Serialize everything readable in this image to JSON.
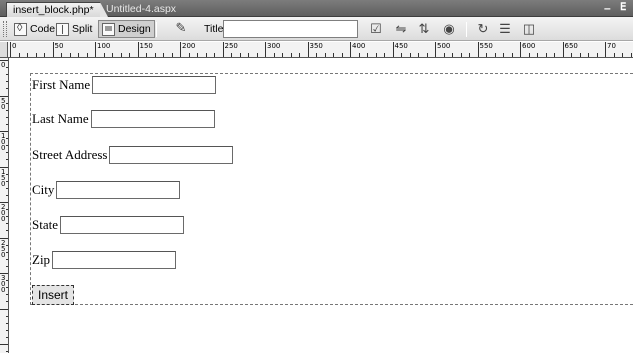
{
  "tabs": [
    {
      "label": "insert_block.php*",
      "active": true
    },
    {
      "label": "Untitled-4.aspx",
      "active": false
    }
  ],
  "window_controls": {
    "minimize": "–",
    "restore": "ⴹ"
  },
  "toolbar": {
    "code_label": "Code",
    "split_label": "Split",
    "design_label": "Design",
    "active_view": "Design",
    "title_label": "Title:",
    "title_value": "",
    "icons": [
      "live-data-icon",
      "browser-check-icon",
      "file-management-icon",
      "preview-icon",
      "refresh-icon",
      "view-options-icon",
      "visual-aids-icon"
    ]
  },
  "ruler": {
    "top_labels": [
      "0",
      "50",
      "100",
      "150",
      "200",
      "250",
      "300",
      "350",
      "400",
      "450",
      "500",
      "550",
      "600",
      "650",
      "70"
    ],
    "left_labels": [
      "0",
      "50",
      "100",
      "150",
      "200",
      "250",
      "300"
    ]
  },
  "form": {
    "fields": [
      {
        "label": "First Name",
        "value": ""
      },
      {
        "label": "Last Name",
        "value": ""
      },
      {
        "label": "Street Address",
        "value": ""
      },
      {
        "label": "City",
        "value": ""
      },
      {
        "label": "State",
        "value": ""
      },
      {
        "label": "Zip",
        "value": ""
      }
    ],
    "submit_label": "Insert"
  },
  "colors": {
    "tabbar": "#6b6b6b",
    "toolbar": "#e6e6e6",
    "ruler": "#f3f3f3",
    "canvas": "#ffffff"
  }
}
